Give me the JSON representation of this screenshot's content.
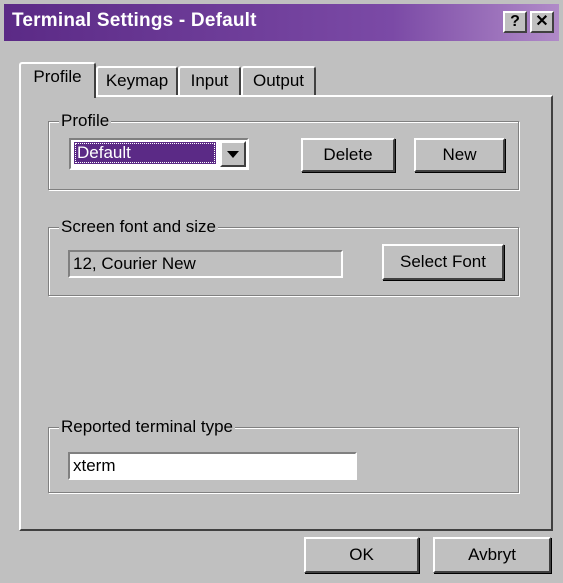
{
  "window": {
    "title": "Terminal Settings - Default"
  },
  "titlebar_buttons": {
    "help": "?",
    "close": "✕"
  },
  "tabs": [
    {
      "label": "Profile",
      "active": true
    },
    {
      "label": "Keymap",
      "active": false
    },
    {
      "label": "Input",
      "active": false
    },
    {
      "label": "Output",
      "active": false
    }
  ],
  "profile_group": {
    "legend": "Profile",
    "selected_profile": "Default",
    "delete_label": "Delete",
    "new_label": "New"
  },
  "font_group": {
    "legend": "Screen font and size",
    "font_value": "12, Courier New",
    "select_font_label": "Select Font"
  },
  "terminal_group": {
    "legend": "Reported terminal type",
    "terminal_value": "xterm"
  },
  "footer": {
    "ok_label": "OK",
    "cancel_label": "Avbryt"
  },
  "colors": {
    "titlebar_accent": "#5b2a86",
    "face": "#c0c0c0"
  }
}
